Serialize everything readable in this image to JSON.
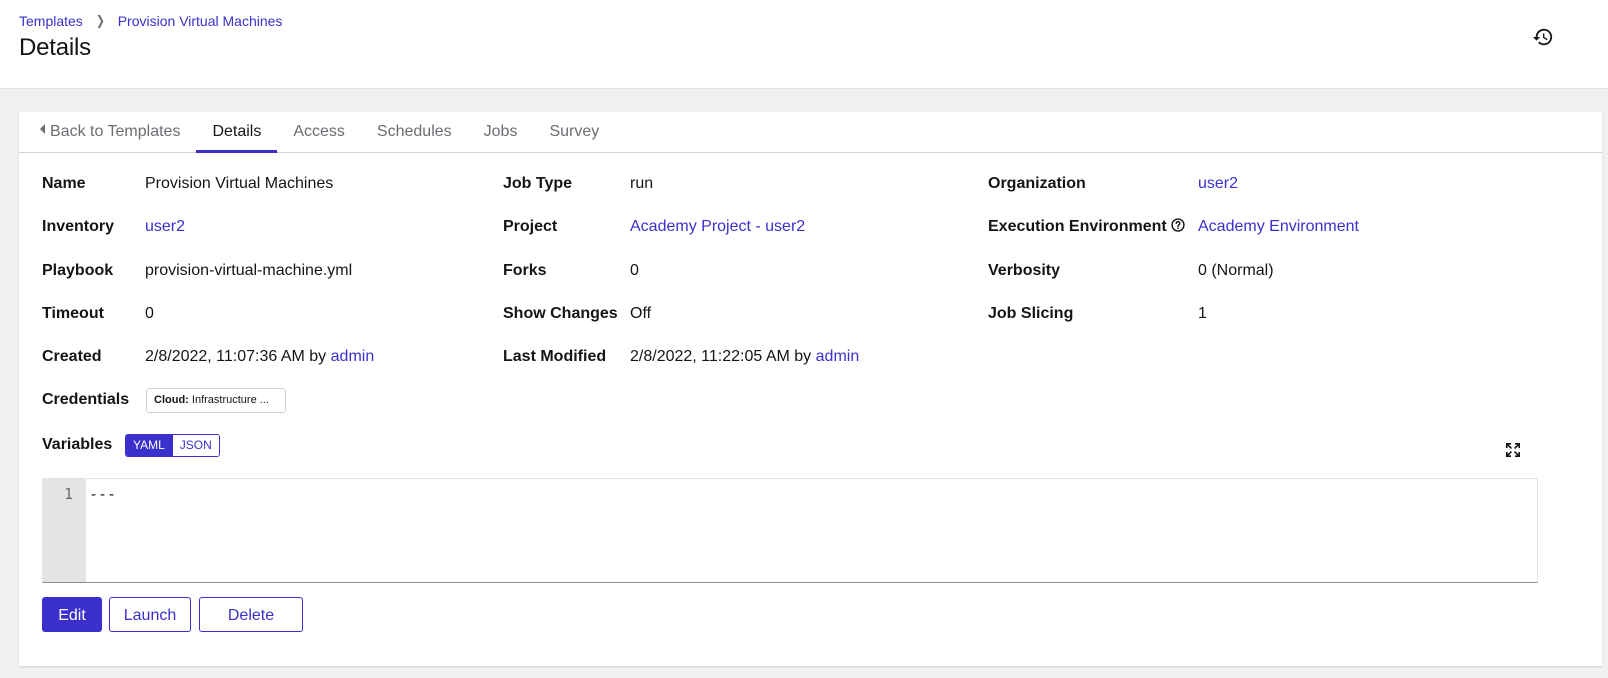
{
  "breadcrumb": {
    "items": [
      "Templates",
      "Provision Virtual Machines"
    ]
  },
  "page": {
    "title": "Details"
  },
  "tabs": [
    {
      "label": "Back to Templates"
    },
    {
      "label": "Details"
    },
    {
      "label": "Access"
    },
    {
      "label": "Schedules"
    },
    {
      "label": "Jobs"
    },
    {
      "label": "Survey"
    }
  ],
  "details": {
    "name": {
      "label": "Name",
      "value": "Provision Virtual Machines"
    },
    "job_type": {
      "label": "Job Type",
      "value": "run"
    },
    "organization": {
      "label": "Organization",
      "value": "user2"
    },
    "inventory": {
      "label": "Inventory",
      "value": "user2"
    },
    "project": {
      "label": "Project",
      "value": "Academy Project - user2"
    },
    "execution_environment": {
      "label": "Execution Environment",
      "value": "Academy Environment"
    },
    "playbook": {
      "label": "Playbook",
      "value": "provision-virtual-machine.yml"
    },
    "forks": {
      "label": "Forks",
      "value": "0"
    },
    "verbosity": {
      "label": "Verbosity",
      "value": "0 (Normal)"
    },
    "timeout": {
      "label": "Timeout",
      "value": "0"
    },
    "show_changes": {
      "label": "Show Changes",
      "value": "Off"
    },
    "job_slicing": {
      "label": "Job Slicing",
      "value": "1"
    },
    "created": {
      "label": "Created",
      "date": "2/8/2022, 11:07:36 AM",
      "by": "by",
      "user": "admin"
    },
    "last_modified": {
      "label": "Last Modified",
      "date": "2/8/2022, 11:22:05 AM",
      "by": "by",
      "user": "admin"
    },
    "credentials": {
      "label": "Credentials",
      "chip_type": "Cloud:",
      "chip_value": "Infrastructure ..."
    },
    "variables": {
      "label": "Variables",
      "yaml": "YAML",
      "json": "JSON",
      "selected": "YAML"
    }
  },
  "editor": {
    "line_number": "1",
    "content": "---"
  },
  "actions": {
    "edit": "Edit",
    "launch": "Launch",
    "delete": "Delete"
  },
  "icons": {
    "history": "history-icon",
    "help": "question-circle-icon",
    "expand": "expand-icon",
    "breadcrumb_separator": "chevron-right-icon",
    "back_caret": "caret-left-icon"
  },
  "colors": {
    "accent": "#3b30cc",
    "text": "#151515",
    "muted": "#6a6e73",
    "background": "#f0f0f0"
  }
}
